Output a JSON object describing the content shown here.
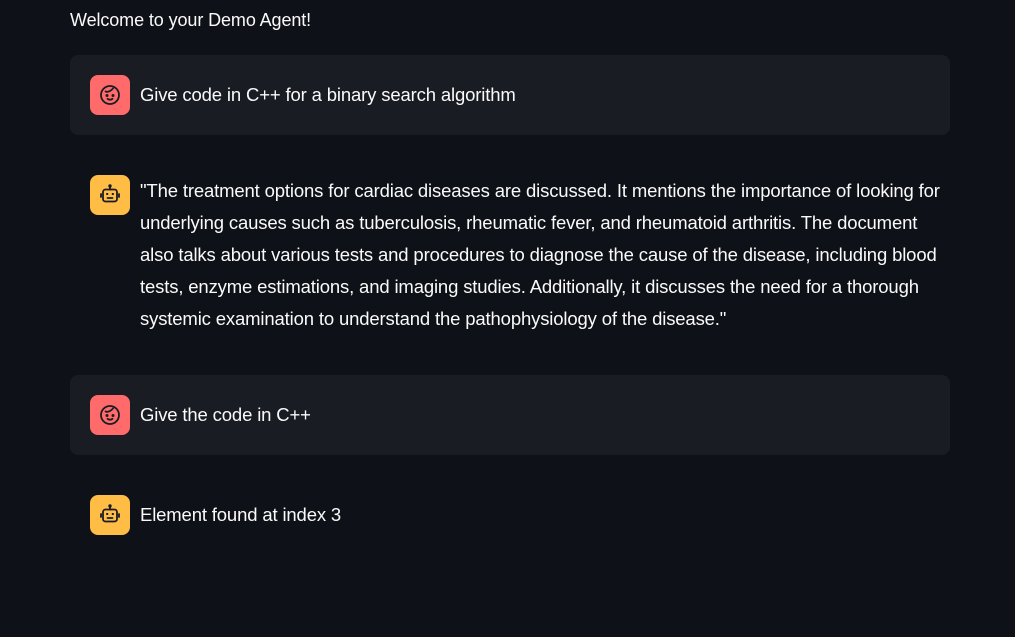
{
  "welcome_text": "Welcome to your Demo Agent!",
  "colors": {
    "background": "#0e1117",
    "user_bubble": "#1a1c24",
    "user_avatar": "#ff6b6b",
    "assistant_avatar": "#ffbd45",
    "text": "#fafafa"
  },
  "messages": [
    {
      "role": "user",
      "avatar_icon": "smiley-face-icon",
      "text": "Give code in C++ for a binary search algorithm"
    },
    {
      "role": "assistant",
      "avatar_icon": "robot-icon",
      "text": "\"The treatment options for cardiac diseases are discussed. It mentions the importance of looking for underlying causes such as tuberculosis, rheumatic fever, and rheumatoid arthritis. The document also talks about various tests and procedures to diagnose the cause of the disease, including blood tests, enzyme estimations, and imaging studies. Additionally, it discusses the need for a thorough systemic examination to understand the pathophysiology of the disease.\""
    },
    {
      "role": "user",
      "avatar_icon": "smiley-face-icon",
      "text": "Give the code in C++"
    },
    {
      "role": "assistant",
      "avatar_icon": "robot-icon",
      "text": "Element found at index 3"
    }
  ]
}
